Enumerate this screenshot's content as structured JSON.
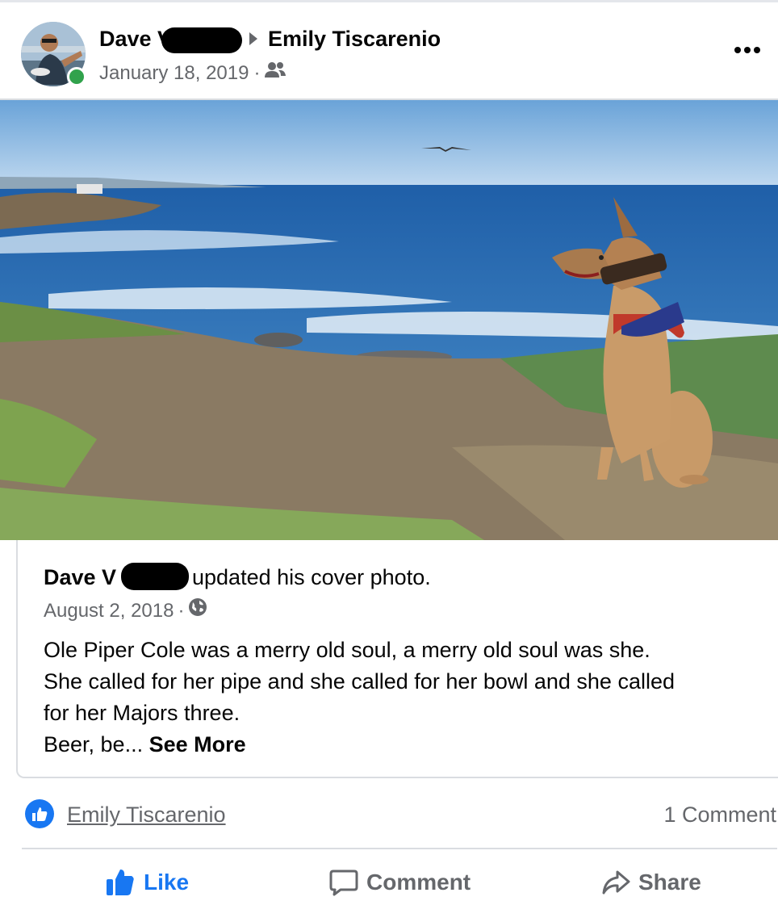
{
  "post": {
    "author": "Dave V",
    "recipient": "Emily Tiscarenio",
    "date": "January 18, 2019",
    "date_separator": "·",
    "audience_icon": "friends-icon",
    "more_icon": "more-options-icon"
  },
  "shared": {
    "author": "Dave V",
    "action": "updated his cover photo.",
    "date": "August 2, 2018",
    "date_separator": "·",
    "audience_icon": "globe-icon",
    "text_lines": [
      "Ole Piper Cole was a merry old soul, a merry old soul was she.",
      "She called for her pipe and she called for her bowl and she called",
      "for her Majors three."
    ],
    "truncated_text": "Beer, be...",
    "see_more": "See More"
  },
  "reactions": {
    "icon": "like-reaction-icon",
    "reactor": "Emily Tiscarenio",
    "comments": "1 Comment"
  },
  "actions": {
    "like": "Like",
    "comment": "Comment",
    "share": "Share"
  },
  "colors": {
    "accent": "#1877f2",
    "secondary_text": "#65676b",
    "online": "#31a24c"
  }
}
